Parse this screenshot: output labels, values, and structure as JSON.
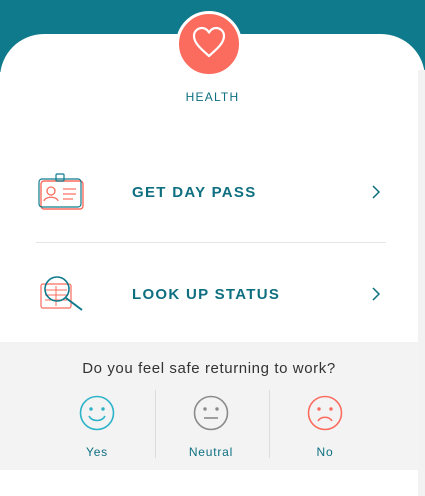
{
  "header": {
    "badge_icon": "heart-icon",
    "badge_label": "HEALTH",
    "accent_color": "#0e7a8c",
    "badge_color": "#fb6c5e"
  },
  "menu": [
    {
      "label": "GET DAY PASS",
      "icon": "id-badge-icon"
    },
    {
      "label": "LOOK UP STATUS",
      "icon": "magnifier-document-icon"
    }
  ],
  "survey": {
    "question": "Do you feel safe returning to work?",
    "options": [
      {
        "label": "Yes",
        "icon": "happy-face-icon",
        "color": "#2bb3c8"
      },
      {
        "label": "Neutral",
        "icon": "neutral-face-icon",
        "color": "#8a8a8a"
      },
      {
        "label": "No",
        "icon": "sad-face-icon",
        "color": "#fb6c5e"
      }
    ]
  }
}
